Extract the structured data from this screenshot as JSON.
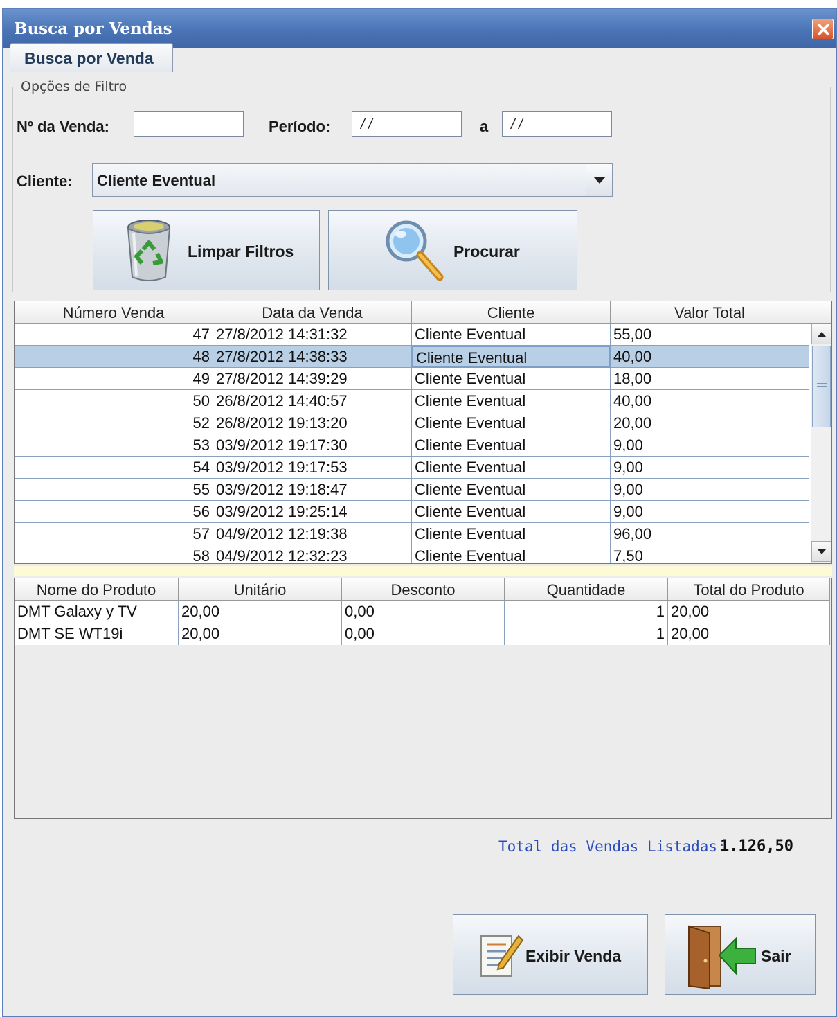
{
  "window": {
    "title": "Busca por Vendas"
  },
  "tabs": [
    {
      "label": "Busca por Venda"
    }
  ],
  "filter": {
    "legend": "Opções de Filtro",
    "numero_label": "Nº da Venda:",
    "numero_value": "",
    "periodo_label": "Período:",
    "periodo_de_value": "/ /",
    "periodo_sep": "a",
    "periodo_ate_value": "/ /",
    "cliente_label": "Cliente:",
    "cliente_value": "Cliente Eventual"
  },
  "buttons": {
    "clear": "Limpar Filtros",
    "search": "Procurar",
    "view": "Exibir Venda",
    "exit": "Sair"
  },
  "sales_table": {
    "columns": [
      "Número Venda",
      "Data da Venda",
      "Cliente",
      "Valor Total"
    ],
    "selected_index": 1,
    "rows": [
      [
        "47",
        "27/8/2012 14:31:32",
        "Cliente Eventual",
        "55,00"
      ],
      [
        "48",
        "27/8/2012 14:38:33",
        "Cliente Eventual",
        "40,00"
      ],
      [
        "49",
        "27/8/2012 14:39:29",
        "Cliente Eventual",
        "18,00"
      ],
      [
        "50",
        "26/8/2012 14:40:57",
        "Cliente Eventual",
        "40,00"
      ],
      [
        "52",
        "26/8/2012 19:13:20",
        "Cliente Eventual",
        "20,00"
      ],
      [
        "53",
        "03/9/2012 19:17:30",
        "Cliente Eventual",
        "9,00"
      ],
      [
        "54",
        "03/9/2012 19:17:53",
        "Cliente Eventual",
        "9,00"
      ],
      [
        "55",
        "03/9/2012 19:18:47",
        "Cliente Eventual",
        "9,00"
      ],
      [
        "56",
        "03/9/2012 19:25:14",
        "Cliente Eventual",
        "9,00"
      ],
      [
        "57",
        "04/9/2012 12:19:38",
        "Cliente Eventual",
        "96,00"
      ],
      [
        "58",
        "04/9/2012 12:32:23",
        "Cliente Eventual",
        "7,50"
      ]
    ]
  },
  "products_table": {
    "columns": [
      "Nome do Produto",
      "Unitário",
      "Desconto",
      "Quantidade",
      "Total do Produto"
    ],
    "rows": [
      [
        "DMT Galaxy y TV",
        "20,00",
        "0,00",
        "1",
        "20,00"
      ],
      [
        "DMT SE WT19i",
        "20,00",
        "0,00",
        "1",
        "20,00"
      ]
    ]
  },
  "summary": {
    "label": "Total das Vendas Listadas:",
    "value": "1.126,50"
  },
  "icons": [
    "close-icon",
    "dropdown-arrow-icon",
    "recycle-bin-icon",
    "magnifier-icon",
    "scroll-up-icon",
    "scroll-down-icon",
    "document-edit-icon",
    "exit-door-icon"
  ],
  "colors": {
    "titlebar": "#4a74b6",
    "selection": "#b8cfe5",
    "summary_label": "#2b4dbb",
    "splitter": "#fdfbd6"
  }
}
